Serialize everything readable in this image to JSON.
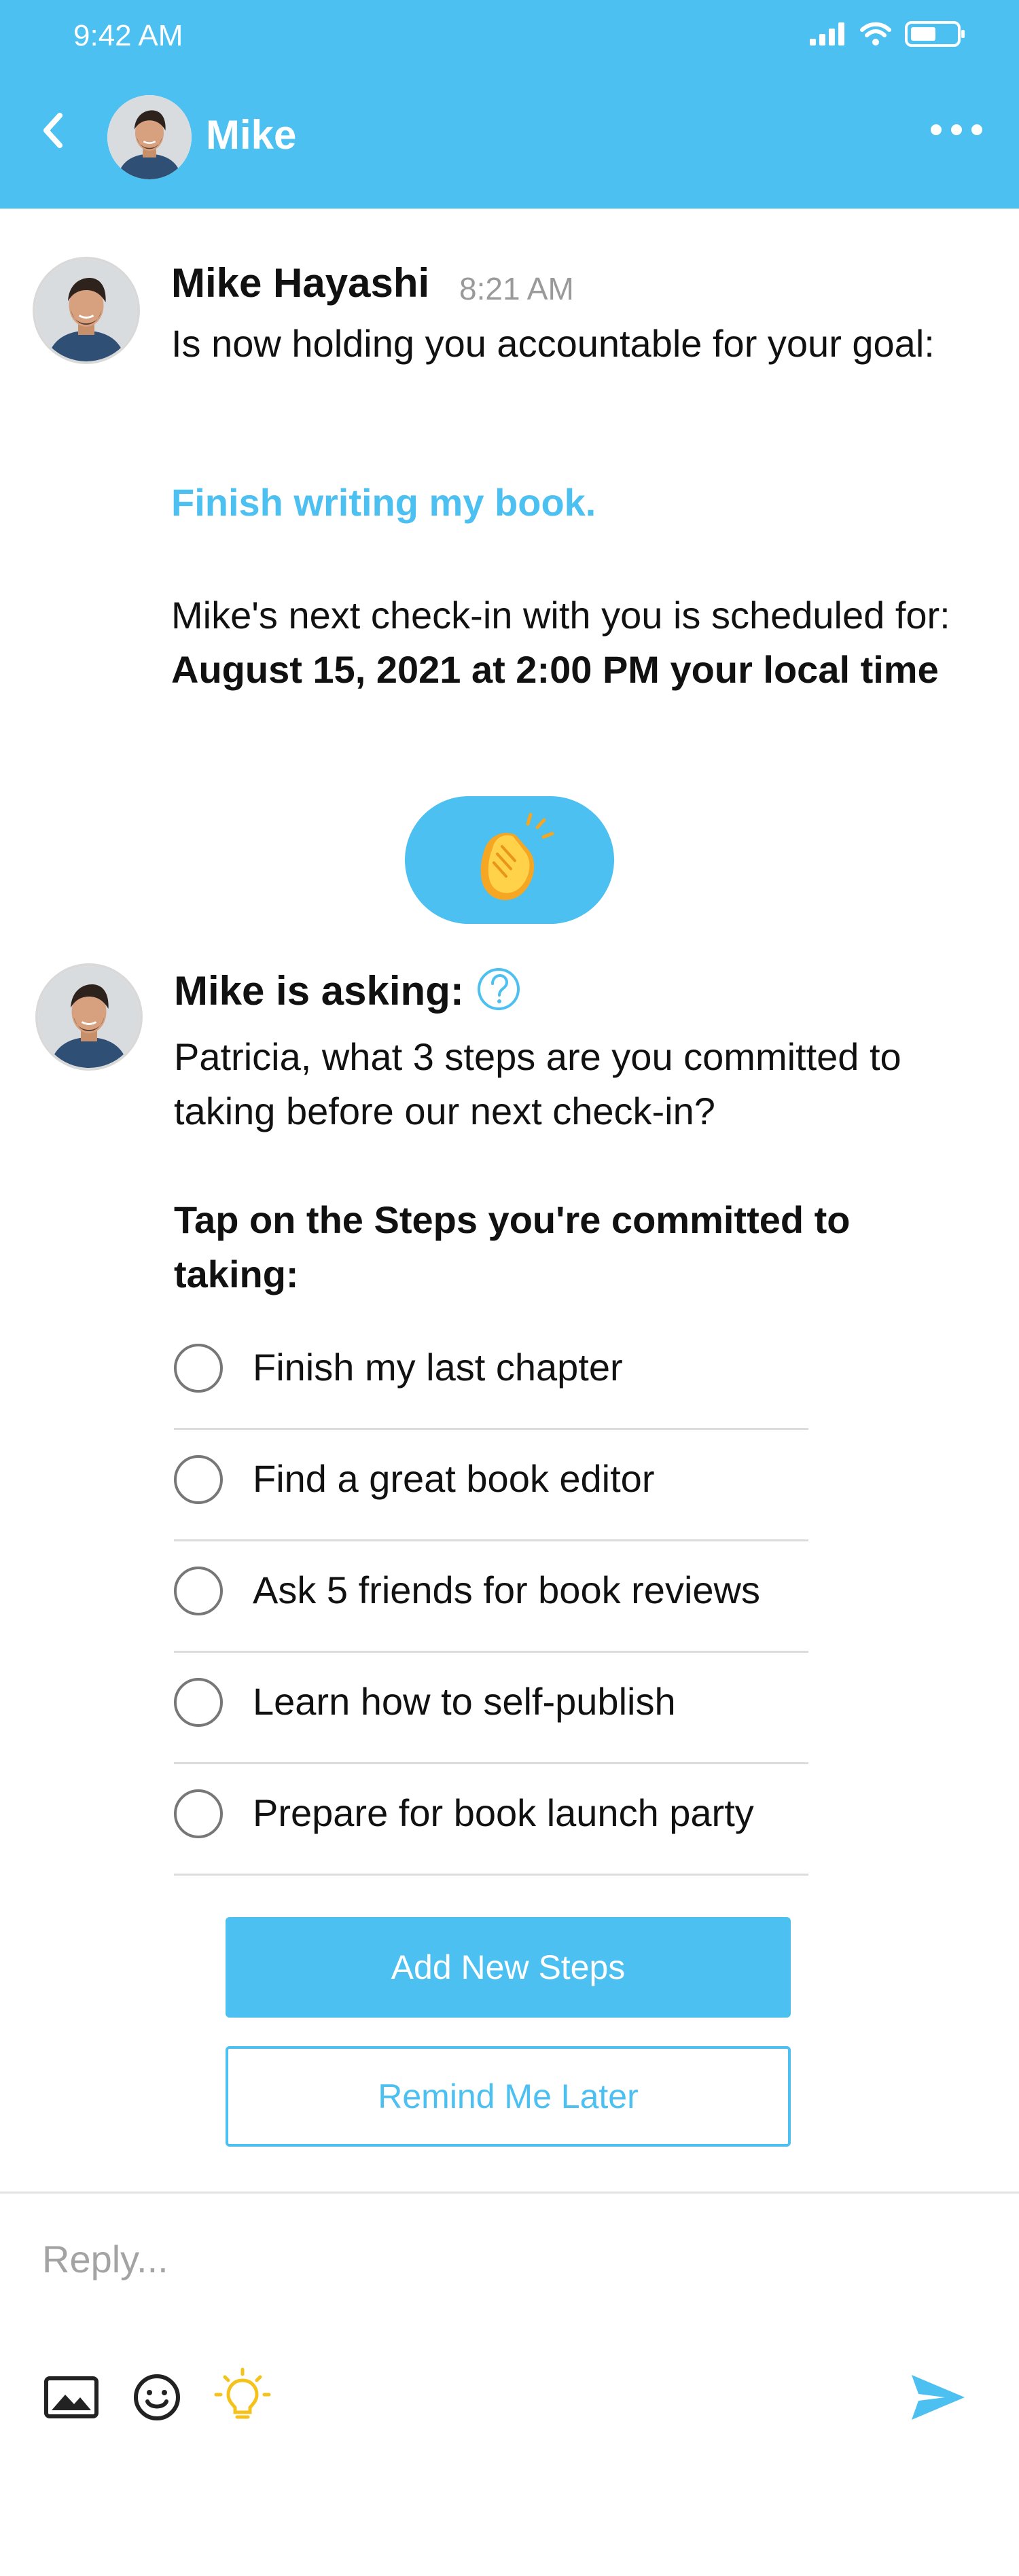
{
  "status_bar": {
    "time": "9:42 AM",
    "icons": [
      "signal-icon",
      "wifi-icon",
      "battery-icon"
    ]
  },
  "header": {
    "back_icon": "chevron-left-icon",
    "contact_name": "Mike",
    "more_icon": "more-horizontal-icon"
  },
  "message1": {
    "sender": "Mike Hayashi",
    "time": "8:21 AM",
    "text": "Is now holding you accountable for your goal:",
    "goal": "Finish writing my book.",
    "checkin_prefix": "Mike's next check-in with you is scheduled for:",
    "checkin_datetime": "August 15, 2021 at 2:00 PM your local time"
  },
  "reaction": {
    "emoji": "clapping-hands-emoji"
  },
  "message2": {
    "heading": "Mike is asking:",
    "question": "Patricia, what 3 steps are you committed to taking before our next check-in?",
    "instruction": "Tap on the Steps you're committed to taking:",
    "steps": [
      "Finish my last chapter",
      "Find a great book editor",
      "Ask 5 friends for book reviews",
      "Learn how to self-publish",
      "Prepare for book launch party"
    ],
    "add_button": "Add New Steps",
    "remind_button": "Remind Me Later"
  },
  "composer": {
    "placeholder": "Reply...",
    "tools": [
      "image-icon",
      "emoji-icon",
      "lightbulb-icon"
    ],
    "send_icon": "send-icon"
  },
  "colors": {
    "accent": "#4BC0F1",
    "text": "#111111",
    "muted": "#9A9A9A",
    "lightbulb": "#F5C21B"
  }
}
